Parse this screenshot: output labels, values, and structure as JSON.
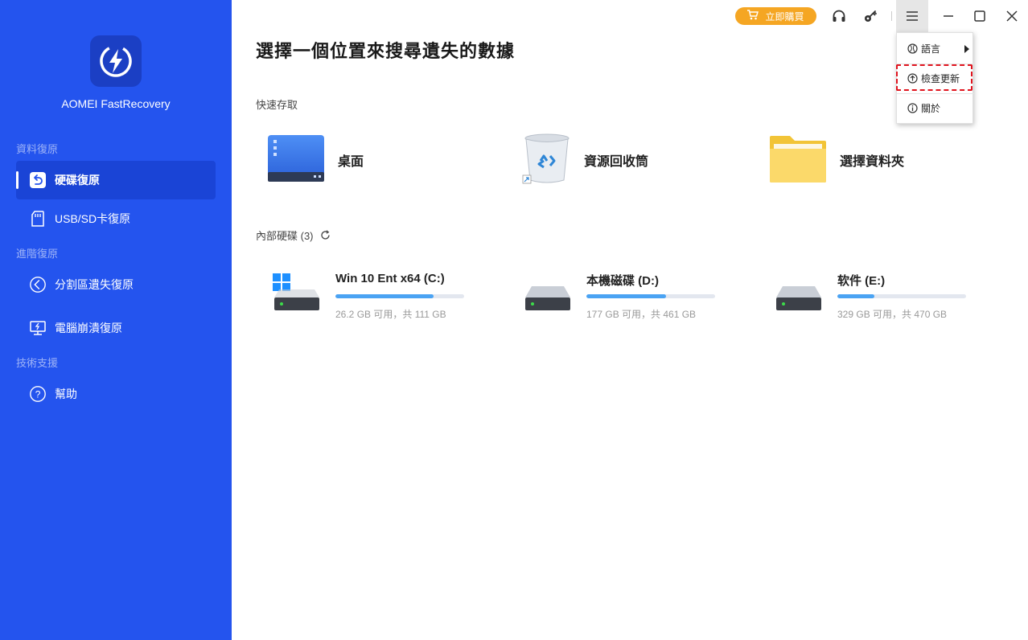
{
  "app": {
    "name": "AOMEI FastRecovery"
  },
  "sidebar": {
    "sections": [
      {
        "label": "資料復原"
      },
      {
        "label": "進階復原"
      },
      {
        "label": "技術支援"
      }
    ],
    "items": [
      {
        "label": "硬碟復原",
        "icon": "drive-restore-icon",
        "active": true
      },
      {
        "label": "USB/SD卡復原",
        "icon": "sd-card-icon"
      },
      {
        "label": "分割區遺失復原",
        "icon": "partition-icon"
      },
      {
        "label": "電腦崩潰復原",
        "icon": "monitor-crash-icon"
      },
      {
        "label": "幫助",
        "icon": "help-icon"
      }
    ]
  },
  "titlebar": {
    "buy_label": "立即購買"
  },
  "menu": {
    "items": [
      {
        "label": "語言",
        "icon": "globe-icon"
      },
      {
        "label": "檢查更新",
        "icon": "update-icon"
      },
      {
        "label": "關於",
        "icon": "info-icon"
      }
    ]
  },
  "main": {
    "title": "選擇一個位置來搜尋遺失的數據",
    "quick_access": {
      "label": "快速存取",
      "items": [
        {
          "label": "桌面",
          "icon": "desktop-icon"
        },
        {
          "label": "資源回收筒",
          "icon": "recycle-bin-icon"
        },
        {
          "label": "選擇資料夾",
          "icon": "folder-icon"
        }
      ]
    },
    "internal_drives": {
      "label": "內部硬碟 (3)",
      "drives": [
        {
          "name": "Win 10 Ent x64 (C:)",
          "info": "26.2 GB 可用，共 111 GB",
          "used_fraction": 0.76,
          "system": true
        },
        {
          "name": "本機磁碟 (D:)",
          "info": "177 GB 可用，共 461 GB",
          "used_fraction": 0.62
        },
        {
          "name": "软件 (E:)",
          "info": "329 GB 可用，共 470 GB",
          "used_fraction": 0.29
        }
      ]
    }
  },
  "colors": {
    "sidebar": "#2454ee",
    "accent": "#f5a623",
    "progress": "#4aa3f3",
    "highlight": "#e0141e"
  }
}
